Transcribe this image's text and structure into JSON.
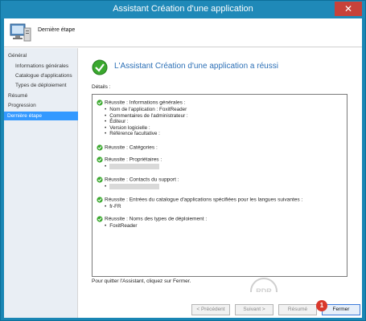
{
  "window": {
    "title": "Assistant Création d'une application",
    "close_glyph": "✕"
  },
  "header": {
    "title": "Dernière étape"
  },
  "sidebar": {
    "items": [
      {
        "label": "Général"
      },
      {
        "label": "Informations générales"
      },
      {
        "label": "Catalogue d'applications"
      },
      {
        "label": "Types de déploiement"
      },
      {
        "label": "Résumé"
      },
      {
        "label": "Progression"
      },
      {
        "label": "Dernière étape"
      }
    ]
  },
  "main": {
    "success_title": "L'Assistant Création d'une application a réussi",
    "details_label": "Détails :",
    "sections": [
      {
        "title": "Réussite : Informations générales :",
        "items": [
          "Nom de l'application : FoxitReader",
          "Commentaires de l'administrateur :",
          "Éditeur :",
          "Version logicielle :",
          "Référence facultative :"
        ]
      },
      {
        "title": "Réussite : Catégories :"
      },
      {
        "title": "Réussite : Propriétaires :"
      },
      {
        "title": "Réussite : Contacts du support :"
      },
      {
        "title": "Réussite : Entrées du catalogue d'applications spécifiées pour les langues suivantes :",
        "items": [
          "fr-FR"
        ]
      },
      {
        "title": "Réussite : Noms des types de déploiement :",
        "items": [
          "FoxitReader"
        ]
      }
    ],
    "quit_text": "Pour quitter l'Assistant, cliquez sur Fermer."
  },
  "footer": {
    "prev_label": "< Précédent",
    "next_label": "Suivant >",
    "summary_label": "Résumé",
    "close_label": "Fermer",
    "badge": "1"
  },
  "watermark": "RDR",
  "colors": {
    "titlebar": "#1f89b8",
    "accent": "#2b6fb6",
    "success": "#3aa82e",
    "close": "#c7423a",
    "badge": "#d9382c"
  }
}
